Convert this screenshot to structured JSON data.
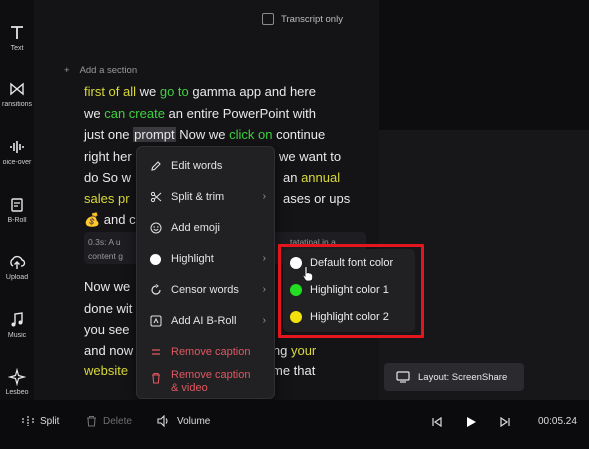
{
  "rail": {
    "items": [
      {
        "label": "Text",
        "icon": "text-icon"
      },
      {
        "label": "ransitions",
        "icon": "transitions-icon"
      },
      {
        "label": "oice-over",
        "icon": "voice-over-icon"
      },
      {
        "label": "B-Roll",
        "icon": "b-roll-icon"
      },
      {
        "label": "Upload",
        "icon": "upload-icon"
      },
      {
        "label": "Music",
        "icon": "music-icon"
      },
      {
        "label": "Lesbeo",
        "icon": "sparkle-icon"
      }
    ]
  },
  "transcript": {
    "transcript_only_label": "Transcript only",
    "add_section_label": "Add a section",
    "note_duration": "0.3s:",
    "note_line1": "A u",
    "note_line1_end": "tatatinal in a",
    "note_line2": "content g",
    "lines": {
      "l1": {
        "a": "first of all",
        "b": " we ",
        "c": "go to",
        "d": " gamma app and here"
      },
      "l2": {
        "a": "we ",
        "b": "can create",
        "c": " an entire PowerPoint with"
      },
      "l3": {
        "a": "just one ",
        "b": "prompt",
        "c": " Now we ",
        "d": "click on",
        "e": " continue"
      },
      "l4": {
        "a": "right her",
        "b": "we want to"
      },
      "l5": {
        "a": "do So w",
        "b": "an ",
        "c": "annual"
      },
      "l6": {
        "a": "sales pr",
        "b": "ases or ups"
      },
      "l7": {
        "a": "💰 and c"
      },
      "l8": {
        "a": "Now we"
      },
      "l9": {
        "a": "done wit"
      },
      "l10": {
        "a": "you see"
      },
      "l11": {
        "a": "and now",
        "b": "ing ",
        "c": "your"
      },
      "l12": {
        "a": "website",
        "b": "me that"
      }
    }
  },
  "context_menu": {
    "items": [
      {
        "label": "Edit words",
        "icon": "pencil-icon"
      },
      {
        "label": "Split & trim",
        "icon": "split-icon"
      },
      {
        "label": "Add emoji",
        "icon": "emoji-icon"
      },
      {
        "label": "Highlight",
        "icon": "highlight-icon"
      },
      {
        "label": "Censor words",
        "icon": "censor-icon"
      },
      {
        "label": "Add AI B-Roll",
        "icon": "ai-broll-icon"
      },
      {
        "label": "Remove caption",
        "icon": "remove-caption-icon"
      },
      {
        "label": "Remove caption",
        "icon": "trash-icon",
        "label2": "& video"
      }
    ]
  },
  "highlight_submenu": {
    "items": [
      {
        "label": "Default font color",
        "color": "#ffffff"
      },
      {
        "label": "Highlight color 1",
        "color": "#22dd22"
      },
      {
        "label": "Highlight color 2",
        "color": "#f2e10c"
      }
    ]
  },
  "preview": {
    "layout_label": "Layout: ScreenShare"
  },
  "bottom_bar": {
    "split_label": "Split",
    "delete_label": "Delete",
    "volume_label": "Volume",
    "time": "00:05.24"
  },
  "colors": {
    "highlight_green": "#3fd13f",
    "highlight_yellow": "#d9d93a",
    "danger": "#e0575f",
    "annotation_red": "#e3161d"
  }
}
